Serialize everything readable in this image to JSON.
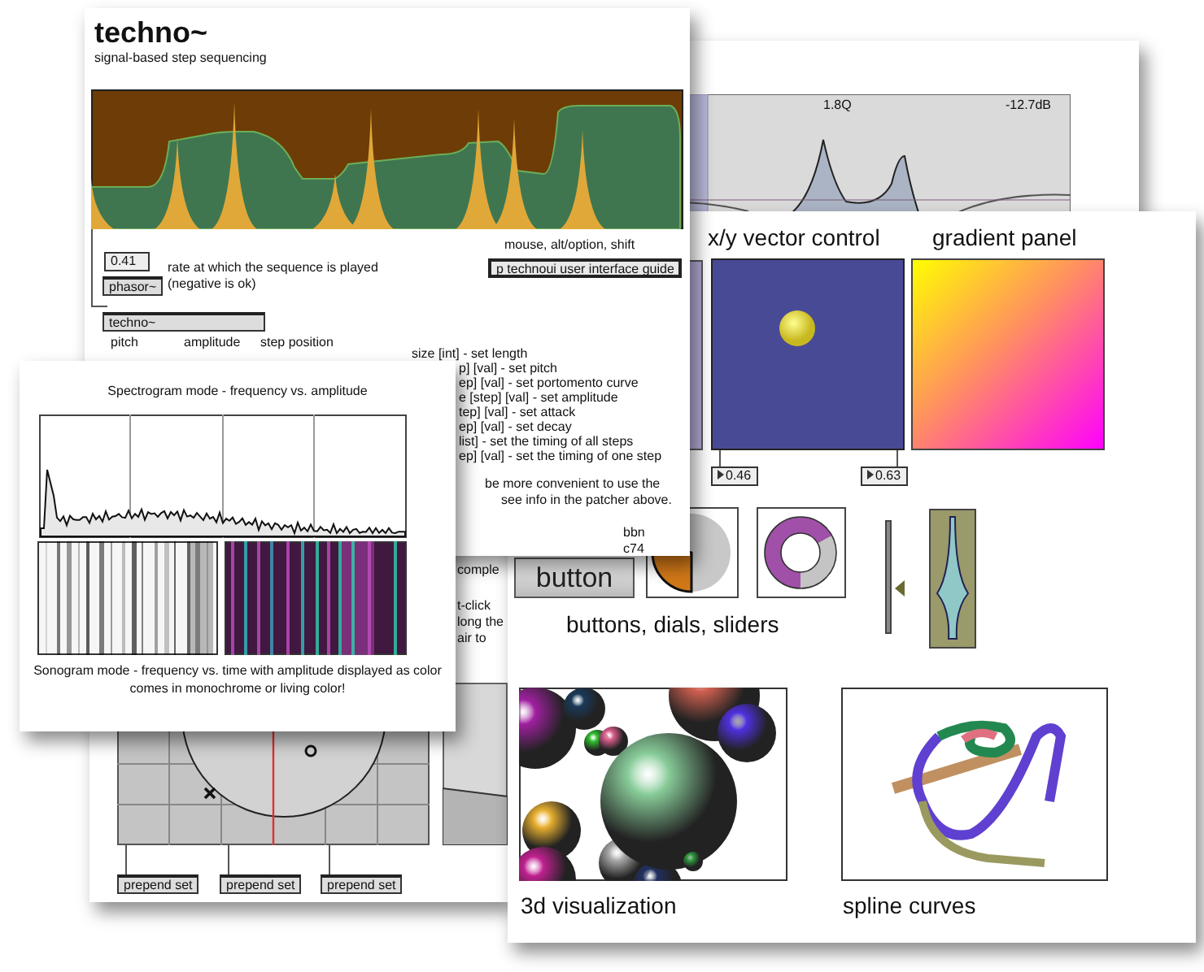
{
  "filter_window": {
    "readouts": [
      "1.8Q",
      "-12.7dB"
    ]
  },
  "patcher_window": {
    "text_fragments": [
      "comple",
      "t-click",
      "long the",
      "air to"
    ],
    "objects": [
      "prepend set",
      "prepend set",
      "prepend set"
    ]
  },
  "demo_window": {
    "xy_title": "x/y vector control",
    "gradient_title": "gradient panel",
    "number_boxes": [
      "0.46",
      "0.63"
    ],
    "button": "button",
    "slider": {
      "level": 0.4
    },
    "controls_title": "buttons, dials, sliders",
    "visualization_title": "3d visualization",
    "spline_title": "spline curves"
  },
  "techno_window": {
    "title": "techno~",
    "subtitle": "signal-based step sequencing",
    "modifier_hint": "mouse, alt/option, shift",
    "guide_button": "p technoui user interface guide",
    "rate_box": "0.41",
    "rate_description": "rate at which the sequence is played\n(negative is ok)",
    "phasor_object": "phasor~",
    "techno_object": "techno~",
    "outlets": [
      "pitch",
      "amplitude",
      "step position"
    ],
    "message_lines": [
      "size [int] - set length",
      "p] [val] - set pitch",
      "ep] [val] - set portomento curve",
      "e [step] [val] - set amplitude",
      "tep] [val] - set attack",
      "ep] [val] - set decay",
      "list] - set the timing of all steps",
      "ep] [val] - set the timing of one step"
    ],
    "note_lines": [
      "be more convenient to use the",
      "see info in the patcher above."
    ],
    "credits": [
      "bbn",
      "c74"
    ]
  },
  "spectrogram_window": {
    "spectrogram_caption": "Spectrogram mode - frequency vs. amplitude",
    "sonogram_caption": "Sonogram mode - frequency vs. time with amplitude displayed as color\ncomes in monochrome or living color!"
  }
}
